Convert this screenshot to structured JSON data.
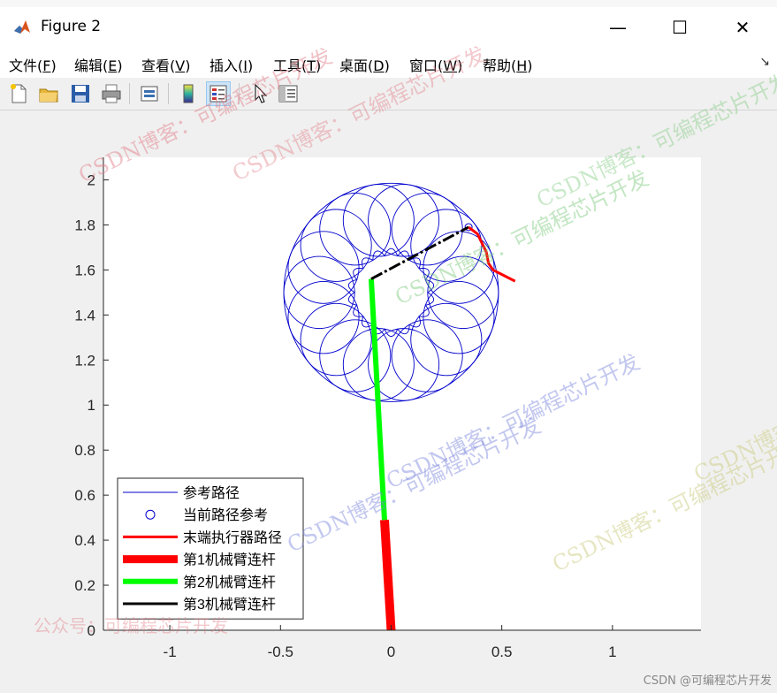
{
  "window": {
    "title": "Figure 2",
    "controls": {
      "minimize": "—",
      "maximize": "☐",
      "close": "✕"
    }
  },
  "menubar": {
    "items": [
      {
        "label": "文件(",
        "key": "F",
        "tail": ")"
      },
      {
        "label": "编辑(",
        "key": "E",
        "tail": ")"
      },
      {
        "label": "查看(",
        "key": "V",
        "tail": ")"
      },
      {
        "label": "插入(",
        "key": "I",
        "tail": ")"
      },
      {
        "label": "工具(",
        "key": "T",
        "tail": ")"
      },
      {
        "label": "桌面(",
        "key": "D",
        "tail": ")"
      },
      {
        "label": "窗口(",
        "key": "W",
        "tail": ")"
      },
      {
        "label": "帮助(",
        "key": "H",
        "tail": ")"
      }
    ],
    "dock_icon": "dock-arrow-icon"
  },
  "toolbar": {
    "buttons": [
      "new-figure-icon",
      "open-file-icon",
      "save-icon",
      "print-icon",
      "print-preview-icon",
      "colorbar-icon",
      "legend-icon",
      "edit-plot-pointer-icon",
      "property-inspector-icon"
    ]
  },
  "watermarks": {
    "a": "CSDN博客：可编程芯片开发",
    "b": "公众号：可编程芯片开发",
    "footer": "CSDN @可编程芯片开发"
  },
  "chart_data": {
    "type": "line",
    "title": "",
    "xlabel": "",
    "ylabel": "",
    "xlim": [
      -1.3,
      1.4
    ],
    "ylim": [
      0,
      2.1
    ],
    "xticks": [
      -1,
      -0.5,
      0,
      0.5,
      1
    ],
    "xtick_labels": [
      "-1",
      "-0.5",
      "0",
      "0.5",
      "1"
    ],
    "yticks": [
      0,
      0.2,
      0.4,
      0.6,
      0.8,
      1,
      1.2,
      1.4,
      1.6,
      1.8,
      2
    ],
    "ytick_labels": [
      "0",
      "0.2",
      "0.4",
      "0.6",
      "0.8",
      "1",
      "1.2",
      "1.4",
      "1.6",
      "1.8",
      "2"
    ],
    "grid": false,
    "legend_location": "bottom-left",
    "colors": {
      "reference_path": "#0000cc",
      "current_ref": "#0000cc",
      "effector": "#ff0000",
      "link1": "#ff0000",
      "link2": "#00ff00",
      "link3": "#000000"
    },
    "reference_path": {
      "center": [
        0,
        1.5
      ],
      "radius_outer": 0.485,
      "petal_radius": 0.16,
      "petal_count": 18,
      "turns": 18
    },
    "current_ref_point": {
      "x": 0.35,
      "y": 1.79
    },
    "effector_path": {
      "x": [
        0.35,
        0.39,
        0.41,
        0.43,
        0.44,
        0.46,
        0.5,
        0.56
      ],
      "y": [
        1.79,
        1.76,
        1.72,
        1.68,
        1.63,
        1.6,
        1.58,
        1.55
      ]
    },
    "links": [
      {
        "name": "link1",
        "x": [
          0,
          -0.03
        ],
        "y": [
          0,
          0.49
        ],
        "width": 10
      },
      {
        "name": "link2",
        "x": [
          -0.03,
          -0.09
        ],
        "y": [
          0.49,
          1.56
        ],
        "width": 6
      },
      {
        "name": "link3",
        "x": [
          -0.09,
          0.35
        ],
        "y": [
          1.56,
          1.79
        ],
        "width": 3,
        "dash": true
      }
    ],
    "legend": [
      {
        "label": "参考路径",
        "style": "thin",
        "color": "#0000cc"
      },
      {
        "label": "当前路径参考",
        "style": "circle",
        "color": "#0000cc"
      },
      {
        "label": "末端执行器路径",
        "style": "medium",
        "color": "#ff0000"
      },
      {
        "label": "第1机械臂连杆",
        "style": "thick",
        "color": "#ff0000"
      },
      {
        "label": "第2机械臂连杆",
        "style": "thick",
        "color": "#00ff00"
      },
      {
        "label": "第3机械臂连杆",
        "style": "medium",
        "color": "#000000"
      }
    ]
  }
}
